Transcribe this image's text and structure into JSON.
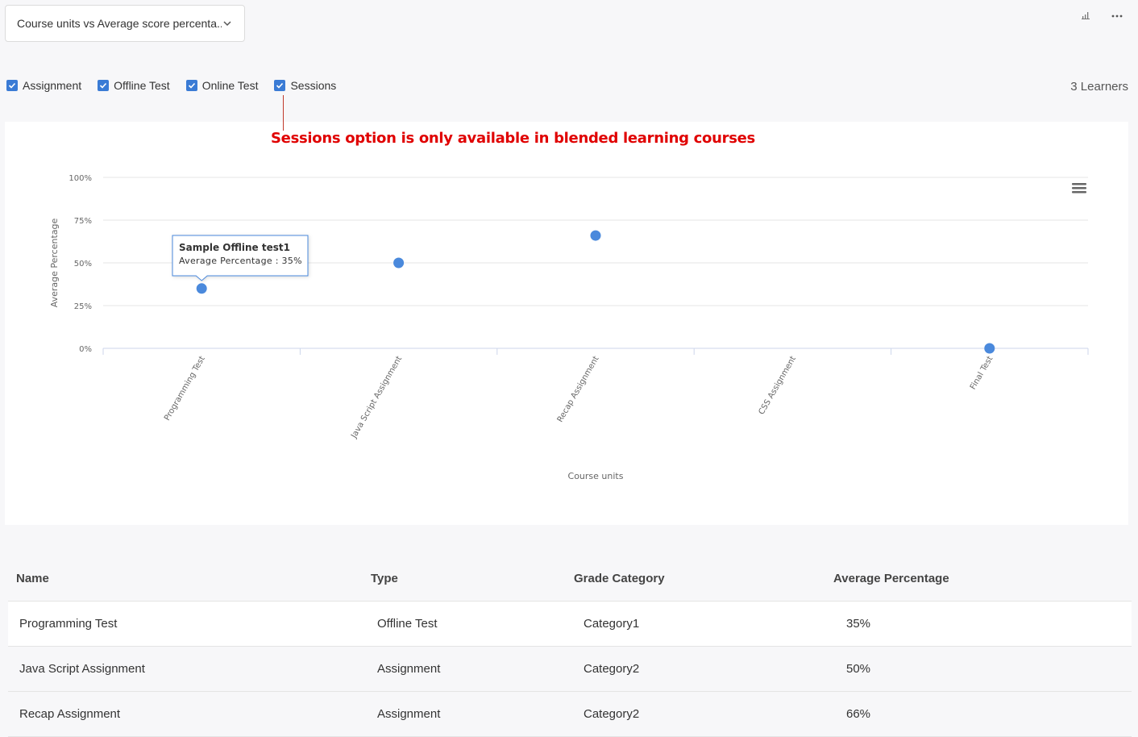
{
  "header": {
    "dropdown_label": "Course units vs Average score percenta...",
    "icons": [
      "bar-chart-icon",
      "more-options-icon"
    ]
  },
  "filters": [
    {
      "label": "Assignment",
      "checked": true
    },
    {
      "label": "Offline Test",
      "checked": true
    },
    {
      "label": "Online Test",
      "checked": true
    },
    {
      "label": "Sessions",
      "checked": true
    }
  ],
  "learners": "3 Learners",
  "annotation": "Sessions option is only available in blended learning courses",
  "chart_data": {
    "type": "scatter",
    "categories": [
      "Programming Test",
      "Java Script Assignment",
      "Recap Assignment",
      "CSS Assignment",
      "Final Test"
    ],
    "values": [
      35,
      50,
      66,
      null,
      0
    ],
    "xlabel": "Course units",
    "ylabel": "Average Percentage",
    "ylim": [
      0,
      100
    ],
    "yticks": [
      "0%",
      "25%",
      "50%",
      "75%",
      "100%"
    ],
    "grid": true,
    "point_color": "#4a89dc",
    "tooltip": {
      "title": "Sample Offline test1",
      "text": "Average Percentage : 35%"
    }
  },
  "table": {
    "headers": [
      "Name",
      "Type",
      "Grade Category",
      "Average Percentage"
    ],
    "rows": [
      [
        "Programming Test",
        "Offline Test",
        "Category1",
        "35%"
      ],
      [
        "Java Script Assignment",
        "Assignment",
        "Category2",
        "50%"
      ],
      [
        "Recap Assignment",
        "Assignment",
        "Category2",
        "66%"
      ]
    ]
  }
}
